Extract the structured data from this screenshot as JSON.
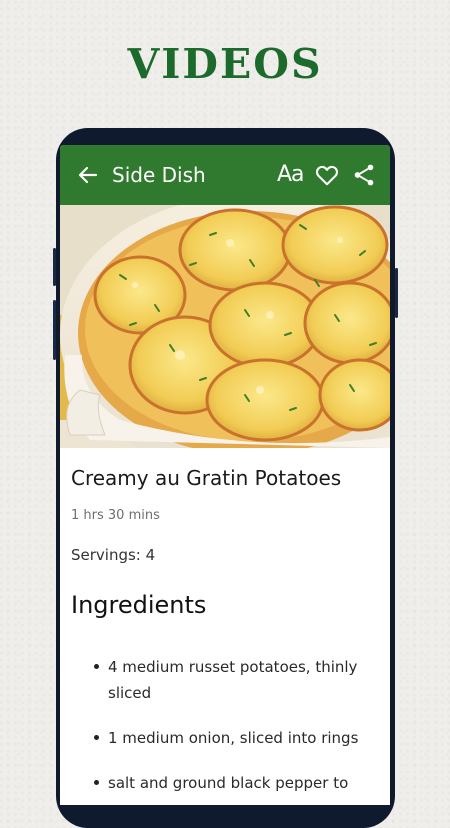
{
  "promo": {
    "title": "VIDEOS"
  },
  "appbar": {
    "title": "Side Dish",
    "text_size_label": "Aa",
    "icons": [
      "back-arrow-icon",
      "text-size-icon",
      "heart-icon",
      "share-icon"
    ]
  },
  "recipe": {
    "title": "Creamy au Gratin Potatoes",
    "time": "1 hrs 30 mins",
    "servings": "Servings: 4",
    "ingredients_heading": "Ingredients",
    "ingredients": [
      "4 medium russet potatoes, thinly sliced",
      "1 medium onion, sliced into rings",
      "salt and ground black pepper to"
    ]
  },
  "colors": {
    "brand_green": "#2f7a2e",
    "promo_green": "#1d6b2c"
  }
}
